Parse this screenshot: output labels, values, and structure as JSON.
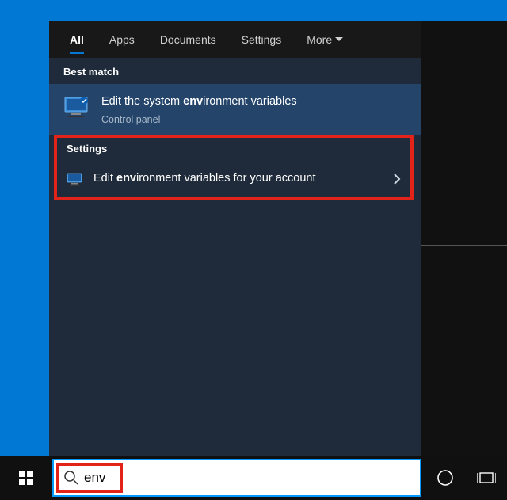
{
  "tabs": {
    "all": "All",
    "apps": "Apps",
    "documents": "Documents",
    "settings": "Settings",
    "more": "More"
  },
  "sections": {
    "best_match": "Best match",
    "settings": "Settings"
  },
  "best_result": {
    "title_pre": "Edit the system ",
    "title_bold": "env",
    "title_post": "ironment variables",
    "sub": "Control panel"
  },
  "settings_result": {
    "title_pre": "Edit ",
    "title_bold": "env",
    "title_post": "ironment variables for your account"
  },
  "search": {
    "value": "env"
  }
}
